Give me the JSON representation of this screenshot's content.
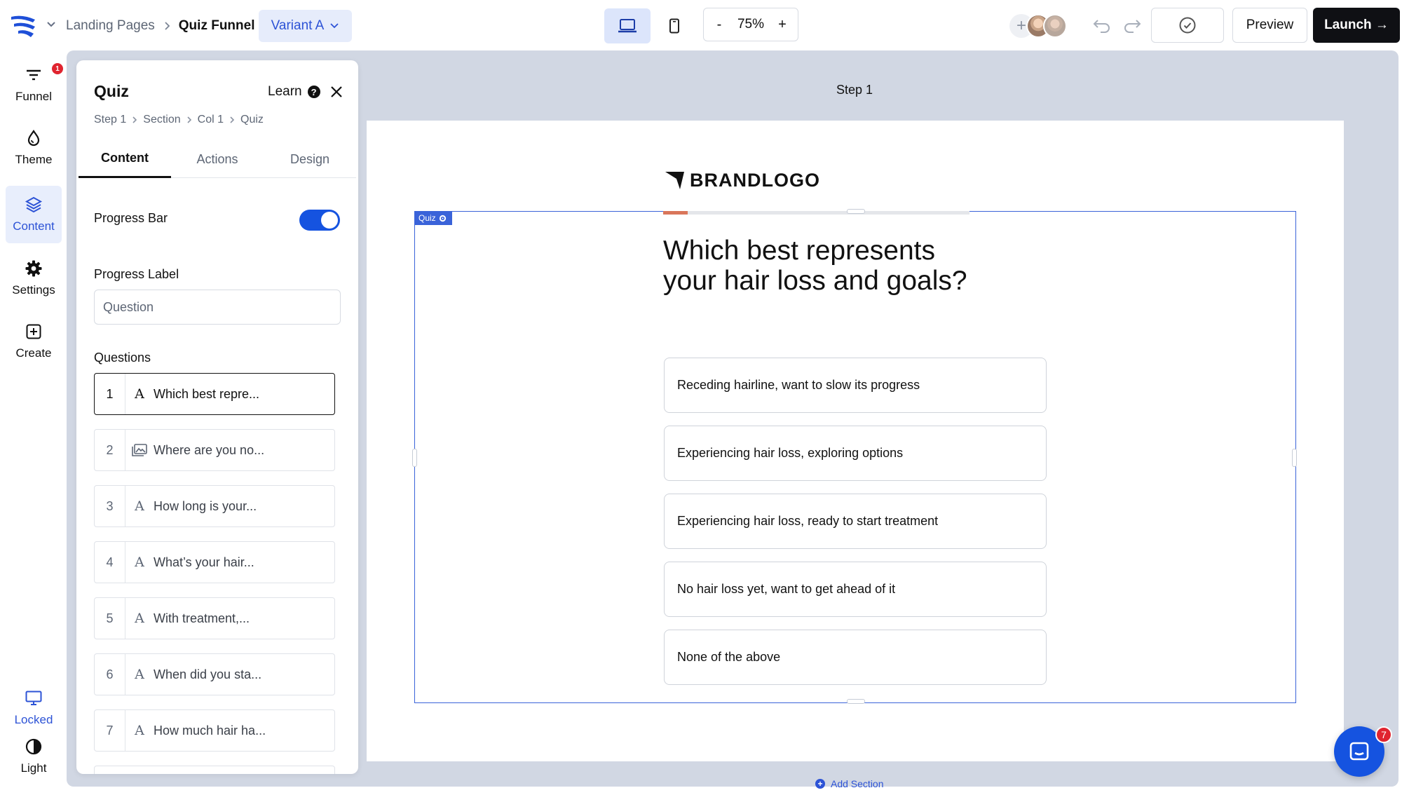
{
  "header": {
    "breadcrumb": [
      "Landing Pages",
      "Quiz Funnel"
    ],
    "variant": "Variant A",
    "zoom": {
      "minus": "-",
      "value": "75%",
      "plus": "+"
    },
    "preview": "Preview",
    "launch": "Launch →"
  },
  "rail": {
    "items": [
      {
        "label": "Funnel",
        "icon": "funnel-icon",
        "badge": "1"
      },
      {
        "label": "Theme",
        "icon": "drop-icon"
      },
      {
        "label": "Content",
        "icon": "layers-icon"
      },
      {
        "label": "Settings",
        "icon": "gear-icon"
      },
      {
        "label": "Create",
        "icon": "plus-square-icon"
      },
      {
        "label": "Locked",
        "icon": "monitor-icon"
      },
      {
        "label": "Light",
        "icon": "contrast-icon"
      }
    ]
  },
  "panel": {
    "title": "Quiz",
    "learn": "Learn",
    "breadcrumb": [
      "Step 1",
      "Section",
      "Col 1",
      "Quiz"
    ],
    "tabs": [
      "Content",
      "Actions",
      "Design"
    ],
    "progress_bar_label": "Progress Bar",
    "progress_bar_on": true,
    "progress_label_label": "Progress Label",
    "progress_label_value": "Question",
    "questions_label": "Questions",
    "questions": [
      {
        "num": "1",
        "icon": "text-icon",
        "text": "Which best repre..."
      },
      {
        "num": "2",
        "icon": "image-icon",
        "text": "Where are you no..."
      },
      {
        "num": "3",
        "icon": "text-icon",
        "text": "How long is your..."
      },
      {
        "num": "4",
        "icon": "text-icon",
        "text": "What’s your hair..."
      },
      {
        "num": "5",
        "icon": "text-icon",
        "text": "With treatment,..."
      },
      {
        "num": "6",
        "icon": "text-icon",
        "text": "When did you sta..."
      },
      {
        "num": "7",
        "icon": "text-icon",
        "text": "How much hair ha..."
      }
    ]
  },
  "canvas": {
    "step": "Step 1",
    "brand": "BRANDLOGO",
    "quiz_tag": "Quiz",
    "progress_fraction": 0.08,
    "question": "Which best represents your hair loss and goals?",
    "options": [
      "Receding hairline, want to slow its progress",
      "Experiencing hair loss, exploring options",
      "Experiencing hair loss, ready to start treatment",
      "No hair loss yet, want to get ahead of it",
      "None of the above"
    ],
    "add_section": "Add Section",
    "chat_badge": "7"
  },
  "colors": {
    "accent": "#1553e0",
    "selection": "#3a63d9",
    "progress": "#d9765a",
    "canvas_bg": "#d1d7e3",
    "launch_bg": "#0f1014"
  }
}
